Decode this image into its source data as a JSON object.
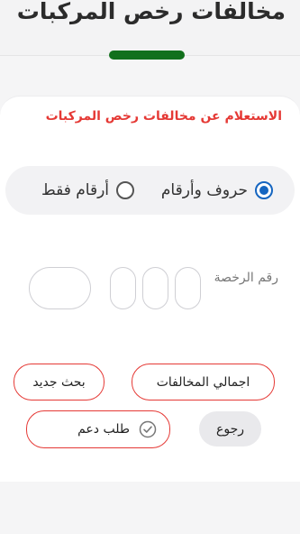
{
  "header": {
    "title": "مخالفات رخص المركبات"
  },
  "section": {
    "title": "الاستعلام عن مخالفات رخص المركبات"
  },
  "search_type": {
    "options": [
      {
        "label": "حروف وأرقام",
        "selected": true
      },
      {
        "label": "أرقام فقط",
        "selected": false
      }
    ]
  },
  "plate": {
    "label": "رقم الرخصة",
    "letter_fields": [
      "",
      "",
      ""
    ],
    "number_field": ""
  },
  "buttons": {
    "total_violations": "اجمالي المخالفات",
    "new_search": "بحث جديد",
    "back": "رجوع",
    "support_request": "طلب دعم"
  },
  "colors": {
    "accent_red": "#e53935",
    "indicator_green": "#12701d",
    "radio_blue": "#1565c0"
  },
  "icons": {
    "support": "check-circle-icon"
  }
}
